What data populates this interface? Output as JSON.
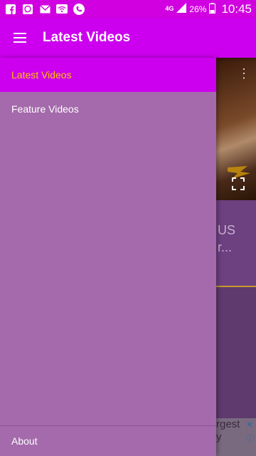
{
  "status_bar": {
    "network_type": "4G",
    "battery": "26%",
    "time": "10:45",
    "left_icons": [
      "facebook-icon",
      "messenger-icon",
      "mail-icon",
      "wifi-icon",
      "phone-icon"
    ]
  },
  "app_bar": {
    "title": "Latest Videos",
    "menu_icon": "hamburger-menu-icon",
    "color": "#cc00ee"
  },
  "drawer": {
    "items": [
      {
        "label": "Latest Videos",
        "active": true
      },
      {
        "label": "Feature Videos",
        "active": false
      }
    ],
    "footer_items": [
      {
        "label": "About"
      }
    ],
    "background": "#a46aab",
    "active_text_color": "#ffc107"
  },
  "background_content": {
    "card_title_fragment": "US\nr...",
    "ad_text_fragment": "rgest\ny"
  }
}
